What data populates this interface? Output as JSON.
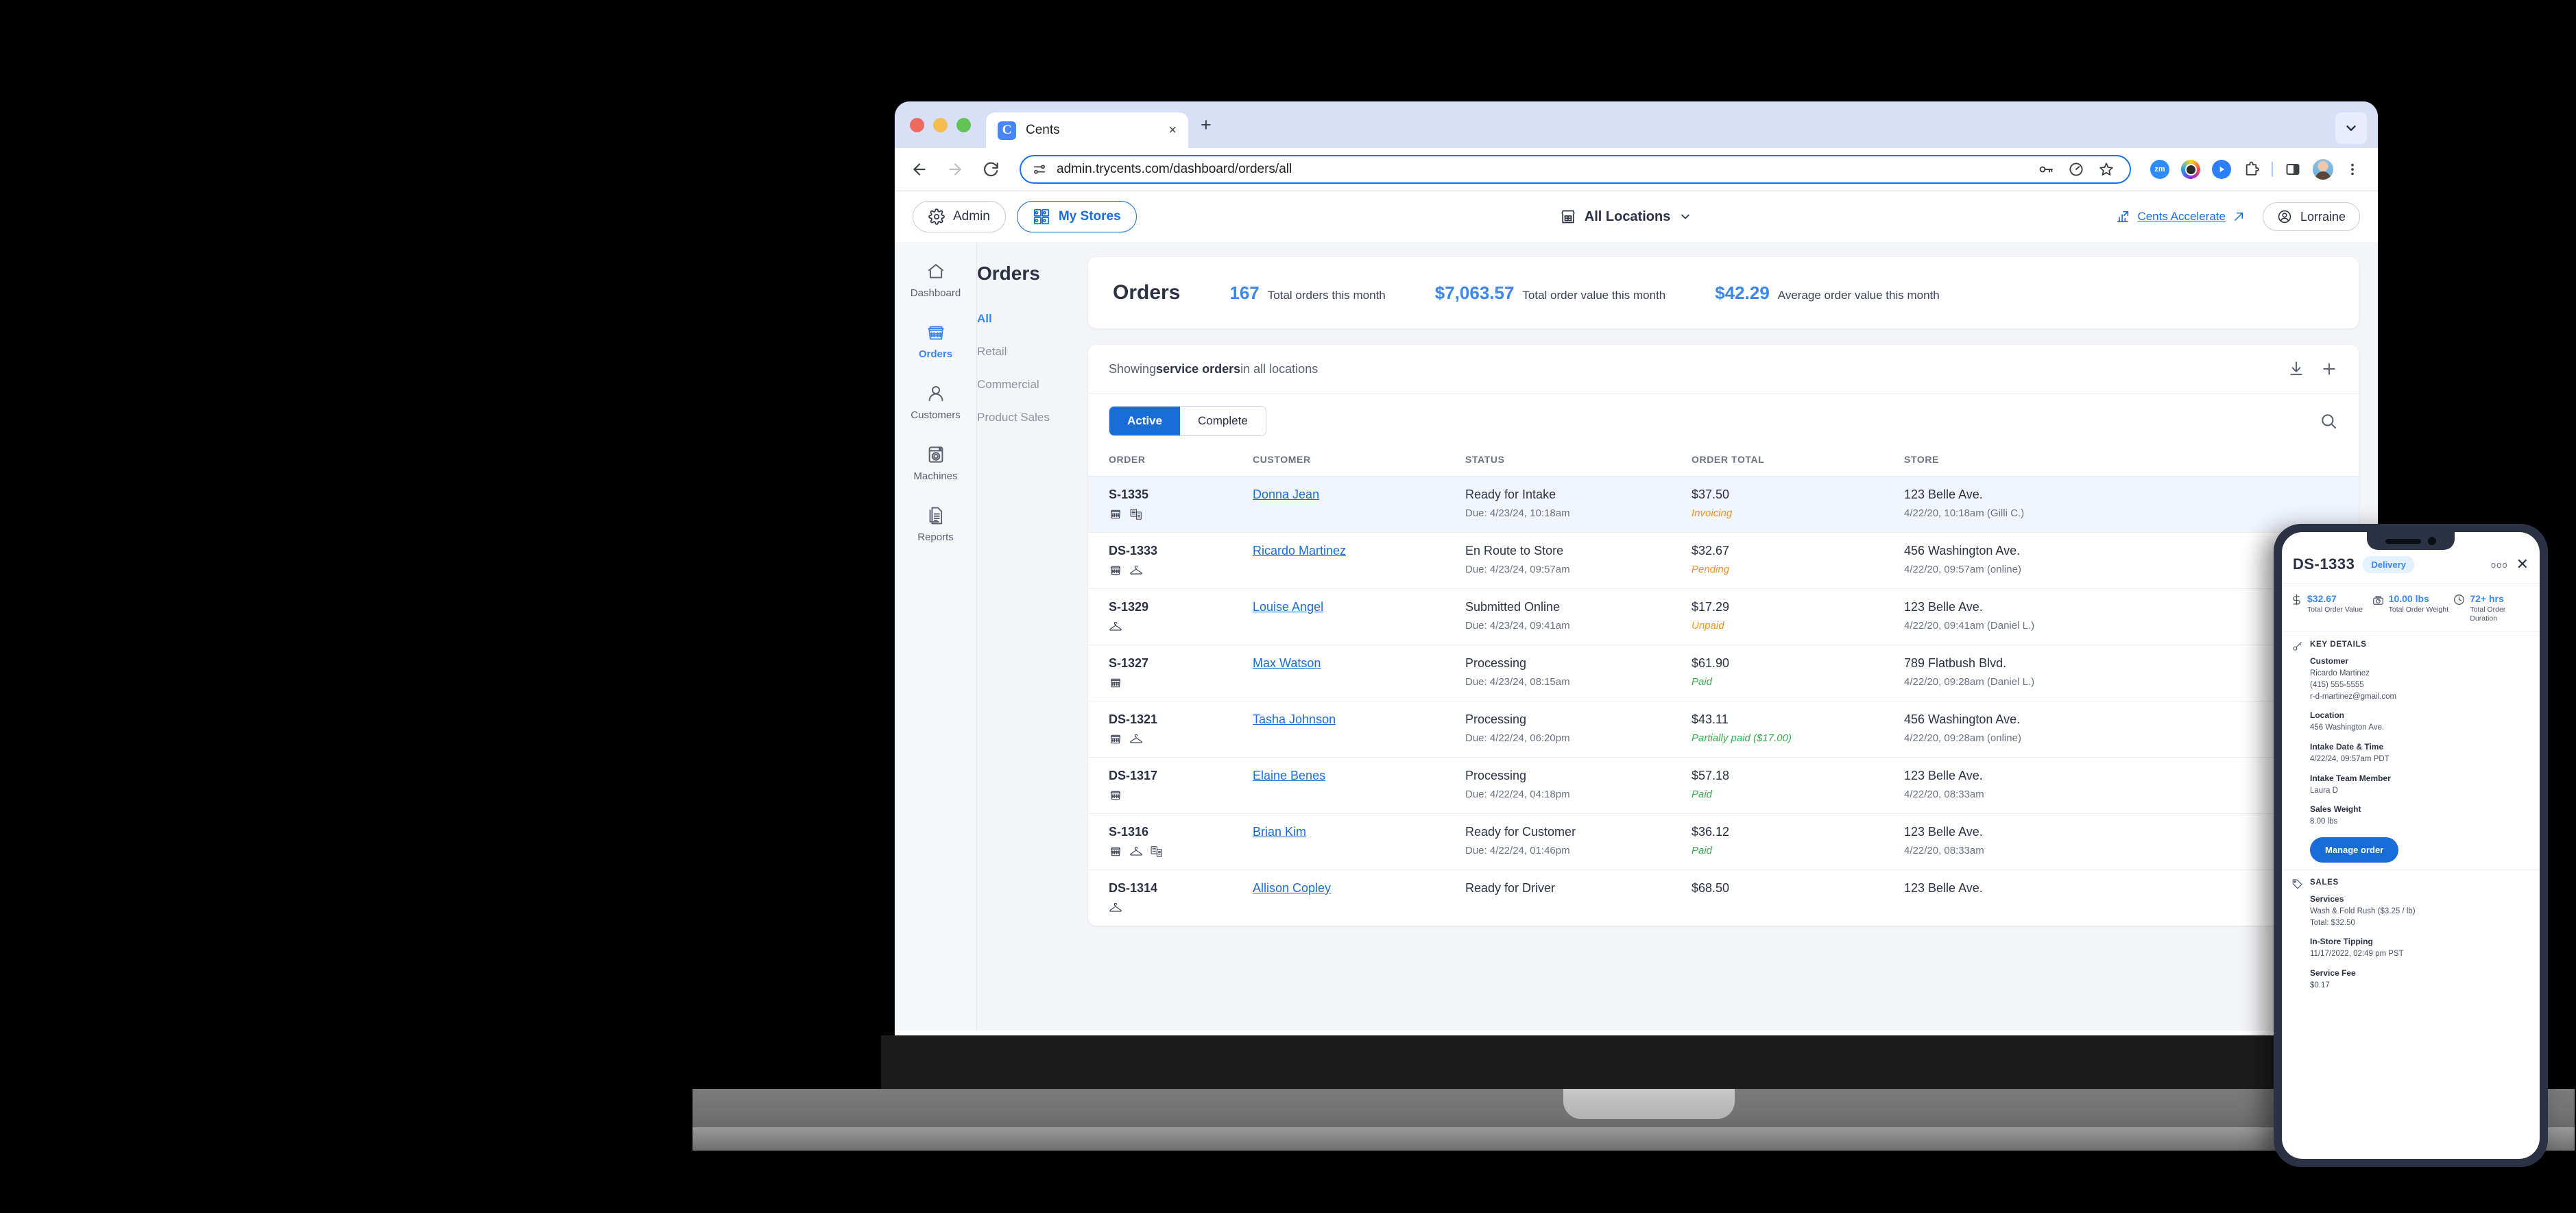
{
  "browser": {
    "tab_title": "Cents",
    "favicon_letter": "C",
    "tab_close_glyph": "×",
    "new_tab_glyph": "+",
    "url": "admin.trycents.com/dashboard/orders/all",
    "extensions": [
      "zm",
      "camera",
      "play",
      "puzzle",
      "side-panel",
      "profile",
      "menu"
    ]
  },
  "app_header": {
    "admin_label": "Admin",
    "my_stores_label": "My Stores",
    "location_label": "All Locations",
    "accelerate_label": "Cents Accelerate",
    "user_label": "Lorraine"
  },
  "rail_nav": {
    "items": [
      {
        "label": "Dashboard",
        "icon": "home-icon",
        "active": false
      },
      {
        "label": "Orders",
        "icon": "basket-icon",
        "active": true
      },
      {
        "label": "Customers",
        "icon": "person-icon",
        "active": false
      },
      {
        "label": "Machines",
        "icon": "washer-icon",
        "active": false
      },
      {
        "label": "Reports",
        "icon": "documents-icon",
        "active": false
      }
    ]
  },
  "sub_nav": {
    "title": "Orders",
    "items": [
      {
        "label": "All",
        "active": true
      },
      {
        "label": "Retail",
        "active": false
      },
      {
        "label": "Commercial",
        "active": false
      },
      {
        "label": "Product Sales",
        "active": false
      }
    ]
  },
  "stats": {
    "title": "Orders",
    "items": [
      {
        "value": "167",
        "label": "Total orders this month"
      },
      {
        "value": "$7,063.57",
        "label": "Total order value this month"
      },
      {
        "value": "$42.29",
        "label": "Average order value this month"
      }
    ]
  },
  "showing": {
    "prefix": "Showing ",
    "bold": "service orders",
    "suffix": " in all locations",
    "download_icon": "download-icon",
    "add_icon": "plus-icon"
  },
  "filters": {
    "segments": [
      {
        "label": "Active",
        "on": true
      },
      {
        "label": "Complete",
        "on": false
      }
    ],
    "search_icon": "search-icon"
  },
  "table": {
    "columns": [
      "ORDER",
      "CUSTOMER",
      "STATUS",
      "ORDER TOTAL",
      "STORE"
    ],
    "rows": [
      {
        "order_id": "S-1335",
        "icons": [
          "basket-icon",
          "garment-stack-icon"
        ],
        "customer": "Donna Jean",
        "status": "Ready for Intake",
        "due": "Due: 4/23/24, 10:18am",
        "total": "$37.50",
        "payment": "Invoicing",
        "payment_state": "pending",
        "store": "123 Belle Ave.",
        "store_meta": "4/22/20, 10:18am (Gilli C.)",
        "selected": true
      },
      {
        "order_id": "DS-1333",
        "icons": [
          "basket-icon",
          "hanger-icon"
        ],
        "customer": "Ricardo Martinez",
        "status": "En Route to Store",
        "due": "Due: 4/23/24, 09:57am",
        "total": "$32.67",
        "payment": "Pending",
        "payment_state": "pending",
        "store": "456 Washington Ave.",
        "store_meta": "4/22/20, 09:57am (online)",
        "selected": false
      },
      {
        "order_id": "S-1329",
        "icons": [
          "hanger-icon"
        ],
        "customer": "Louise Angel",
        "status": "Submitted Online",
        "due": "Due: 4/23/24, 09:41am",
        "total": "$17.29",
        "payment": "Unpaid",
        "payment_state": "pending",
        "store": "123 Belle Ave.",
        "store_meta": "4/22/20, 09:41am (Daniel L.)",
        "selected": false
      },
      {
        "order_id": "S-1327",
        "icons": [
          "basket-icon"
        ],
        "customer": "Max Watson",
        "status": "Processing",
        "due": "Due: 4/23/24, 08:15am",
        "total": "$61.90",
        "payment": "Paid",
        "payment_state": "paid",
        "store": "789 Flatbush Blvd.",
        "store_meta": "4/22/20, 09:28am (Daniel L.)",
        "selected": false
      },
      {
        "order_id": "DS-1321",
        "icons": [
          "basket-icon",
          "hanger-icon"
        ],
        "customer": "Tasha Johnson",
        "status": "Processing",
        "due": "Due: 4/22/24, 06:20pm",
        "total": "$43.11",
        "payment": "Partially paid ($17.00)",
        "payment_state": "paid",
        "store": "456 Washington Ave.",
        "store_meta": "4/22/20, 09:28am (online)",
        "selected": false
      },
      {
        "order_id": "DS-1317",
        "icons": [
          "basket-icon"
        ],
        "customer": "Elaine Benes",
        "status": "Processing",
        "due": "Due: 4/22/24, 04:18pm",
        "total": "$57.18",
        "payment": "Paid",
        "payment_state": "paid",
        "store": "123 Belle Ave.",
        "store_meta": "4/22/20, 08:33am",
        "selected": false
      },
      {
        "order_id": "S-1316",
        "icons": [
          "basket-icon",
          "hanger-icon",
          "garment-stack-icon"
        ],
        "customer": "Brian Kim",
        "status": "Ready for Customer",
        "due": "Due: 4/22/24, 01:46pm",
        "total": "$36.12",
        "payment": "Paid",
        "payment_state": "paid",
        "store": "123 Belle Ave.",
        "store_meta": "4/22/20, 08:33am",
        "selected": false
      },
      {
        "order_id": "DS-1314",
        "icons": [
          "hanger-icon"
        ],
        "customer": "Allison Copley",
        "status": "Ready for Driver",
        "due": "",
        "total": "$68.50",
        "payment": "",
        "payment_state": "paid",
        "store": "123 Belle Ave.",
        "store_meta": "",
        "selected": false
      }
    ]
  },
  "phone": {
    "order_id": "DS-1333",
    "badge": "Delivery",
    "more_glyph": "ooo",
    "close_glyph": "✕",
    "metrics": [
      {
        "icon": "dollar-icon",
        "value": "$32.67",
        "label": "Total Order Value"
      },
      {
        "icon": "scale-icon",
        "value": "10.00 lbs",
        "label": "Total Order Weight"
      },
      {
        "icon": "clock-icon",
        "value": "72+ hrs",
        "label": "Total Order Duration"
      }
    ],
    "key_details": {
      "icon": "key-icon",
      "title": "KEY DETAILS",
      "fields": [
        {
          "key": "Customer",
          "value": "Ricardo Martinez\n(415) 555-5555\nr-d-martinez@gmail.com"
        },
        {
          "key": "Location",
          "value": "456 Washington Ave."
        },
        {
          "key": "Intake Date & Time",
          "value": "4/22/24, 09:57am PDT"
        },
        {
          "key": "Intake Team Member",
          "value": "Laura D"
        },
        {
          "key": "Sales Weight",
          "value": "8.00 lbs"
        }
      ],
      "manage_button": "Manage order"
    },
    "sales": {
      "icon": "tag-icon",
      "title": "SALES",
      "fields": [
        {
          "key": "Services",
          "value": "Wash & Fold Rush ($3.25 / lb)\nTotal: $32.50"
        },
        {
          "key": "In-Store Tipping",
          "value": "11/17/2022, 02:49 pm PST"
        },
        {
          "key": "Service Fee",
          "value": "$0.17"
        }
      ]
    }
  },
  "colors": {
    "accent": "#1a6dd8",
    "link": "#1a6dd8",
    "light_blue": "#3b86f0",
    "pending": "#f0921f",
    "paid": "#39ab4c",
    "ink": "#2b3244"
  }
}
